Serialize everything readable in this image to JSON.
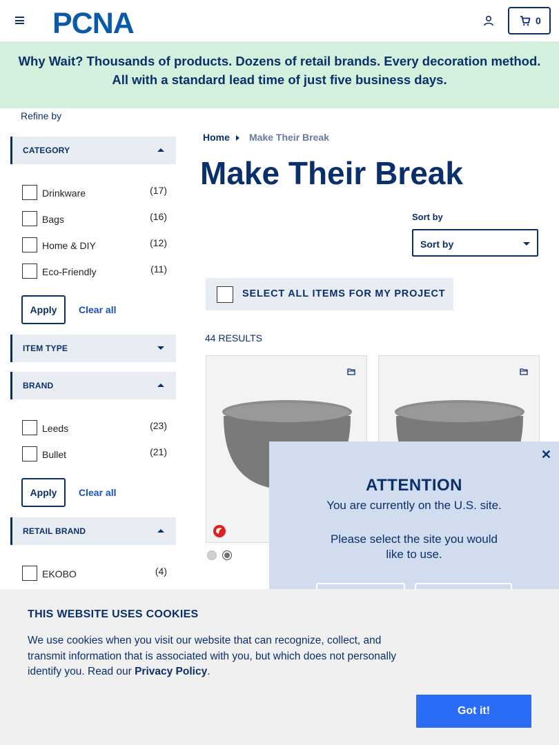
{
  "header": {
    "logo_text": "PCNA",
    "cart_count": "0"
  },
  "promo": {
    "text": "Why Wait? Thousands of products. Dozens of retail brands. Every decoration method. All with a standard lead time of just five business days."
  },
  "sidebar": {
    "refine_label": "Refine by",
    "category": {
      "title": "CATEGORY",
      "options": [
        {
          "label": "Drinkware",
          "count": "(17)"
        },
        {
          "label": "Bags",
          "count": "(16)"
        },
        {
          "label": "Home & DIY",
          "count": "(12)"
        },
        {
          "label": "Eco-Friendly",
          "count": "(11)"
        }
      ],
      "apply": "Apply",
      "clear": "Clear all"
    },
    "item_type": {
      "title": "ITEM TYPE"
    },
    "brand": {
      "title": "BRAND",
      "options": [
        {
          "label": "Leeds",
          "count": "(23)"
        },
        {
          "label": "Bullet",
          "count": "(21)"
        }
      ],
      "apply": "Apply",
      "clear": "Clear all"
    },
    "retail_brand": {
      "title": "RETAIL BRAND",
      "options": [
        {
          "label": "EKOBO",
          "count": "(4)"
        }
      ]
    }
  },
  "main": {
    "breadcrumb_home": "Home",
    "breadcrumb_current": "Make Their Break",
    "title": "Make Their Break",
    "sort_label": "Sort by",
    "sort_value": "Sort by",
    "select_all": "SELECT ALL ITEMS FOR MY PROJECT",
    "results": "44 RESULTS"
  },
  "attention": {
    "title": "ATTENTION",
    "line1": "You are currently on the U.S. site.",
    "line2": "Please select the site you would like to use."
  },
  "cookie": {
    "title": "THIS WEBSITE USES COOKIES",
    "text": "We use cookies when you visit our website that can recognize, collect, and transmit information that is associated with you, but which does not personally identify you. Read our ",
    "link": "Privacy Policy",
    "period": ".",
    "button": "Got it!"
  },
  "colors": {
    "brand_navy": "#0a2f6b",
    "promo_bg": "#d2f0dc",
    "accent_blue": "#2a6cf6"
  }
}
